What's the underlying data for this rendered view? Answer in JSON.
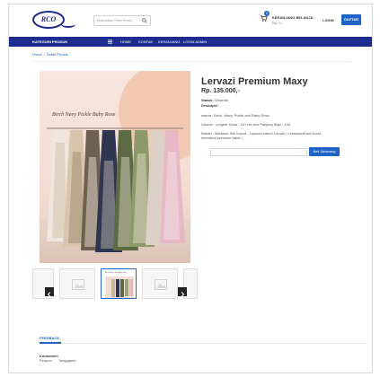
{
  "header": {
    "logo_text": "RCO",
    "search_placeholder": "Masukkan Kata Kunci...",
    "cart_badge": "0",
    "cart_title": "KERANJANG BELANJA :",
    "cart_total": "Rp. 0,-",
    "login_label": "LOGIN",
    "signup_label": "DAFTAR"
  },
  "nav": {
    "category_label": "KATEGORI PRODUK",
    "links": [
      "HOME",
      "KONTAK",
      "KERANJANG",
      "LOGIN ADMIN"
    ]
  },
  "breadcrumb": {
    "home": "Home",
    "current": "Detail Produk"
  },
  "product": {
    "image_caption": "Birch Navy Pickle Baby Rose",
    "title": "Lervazi Premium Maxy",
    "price": "Rp. 135.000,-",
    "status_label": "Status:",
    "status_value": "Tersedia",
    "description_label": "Deskripsi",
    "desc_lines": [
      "warna : Birch, Navy, Pickle and Baby Rose",
      "Ukuran : Lingkar Dada : 110 cm dan Panjang Baju : 138",
      "Bahan : Madame Silk Import , Lapisan katun/ Lemak ( Lemasaziff ant kusut , membuat premium fabric ) ."
    ],
    "buy_label": "Beli Sekarang",
    "thumb_caption": "Birch Navy Pickle Baby Rose"
  },
  "feedback": {
    "tab_label": "FEEDBACK",
    "heading": "Konsumen",
    "columns": [
      "Respon",
      "Tanggapan"
    ]
  },
  "colors": {
    "primary": "#1e63c6",
    "nav": "#1c2d8f"
  }
}
